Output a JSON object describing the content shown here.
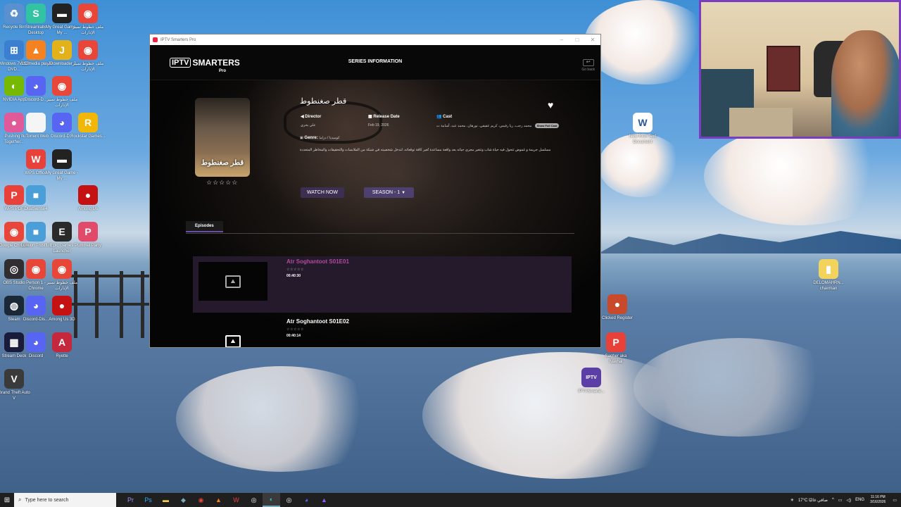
{
  "desktop": {
    "left_icons": [
      {
        "label": "Recycle Bin",
        "icon": "recycle-bin-icon",
        "color": "#5a8fd0",
        "glyph": "♻"
      },
      {
        "label": "Streamlabs Desktop",
        "icon": "streamlabs-icon",
        "color": "#31c3a2",
        "glyph": "S"
      },
      {
        "label": "My Great Game - My ...",
        "icon": "game-icon",
        "color": "#222222",
        "glyph": "▬"
      },
      {
        "label": "ملف خطوط تمييز الإدارات",
        "icon": "chrome-icon",
        "color": "#e9463a",
        "glyph": "◉"
      },
      {
        "label": "Windows 7 USB DVD...",
        "icon": "windows-usb-icon",
        "color": "#3a7fd0",
        "glyph": "⊞"
      },
      {
        "label": "VLC media player",
        "icon": "vlc-icon",
        "color": "#f58220",
        "glyph": "▲"
      },
      {
        "label": "JDownloader 2",
        "icon": "jdownloader-icon",
        "color": "#e3b21b",
        "glyph": "J"
      },
      {
        "label": "ملف خطوط تمييز الإدارات",
        "icon": "chrome-icon",
        "color": "#e9463a",
        "glyph": "◉"
      },
      {
        "label": "NVIDIA App",
        "icon": "nvidia-icon",
        "color": "#76b900",
        "glyph": "◐"
      },
      {
        "label": "Discord-D...",
        "icon": "discord-icon",
        "color": "#5865f2",
        "glyph": "◕"
      },
      {
        "label": "ملف خطوط تمييز الإدارات",
        "icon": "chrome-icon",
        "color": "#e9463a",
        "glyph": "◉"
      },
      {
        "label": "Pushing It Together...",
        "icon": "game2-icon",
        "color": "#e05a9a",
        "glyph": "●"
      },
      {
        "label": "uTorrent Web",
        "icon": "file-icon",
        "color": "#f5f5f5",
        "glyph": ""
      },
      {
        "label": "Discord-D...",
        "icon": "discord-icon",
        "color": "#5865f2",
        "glyph": "◕"
      },
      {
        "label": "Rockstar Games...",
        "icon": "rockstar-icon",
        "color": "#f2b705",
        "glyph": "R"
      },
      {
        "label": "WPS Office",
        "icon": "wps-icon",
        "color": "#e8413a",
        "glyph": "W"
      },
      {
        "label": "My Great Game - My ...",
        "icon": "game-icon",
        "color": "#222222",
        "glyph": "▬"
      },
      {
        "label": "WPS PDF",
        "icon": "wps-pdf-icon",
        "color": "#e8413a",
        "glyph": "P"
      },
      {
        "label": "DualSense4",
        "icon": "app-icon",
        "color": "#4a9fd8",
        "glyph": "■"
      },
      {
        "label": "Among Us",
        "icon": "among-us-icon",
        "color": "#c51111",
        "glyph": "●"
      },
      {
        "label": "Google Chrome",
        "icon": "chrome-icon",
        "color": "#e9463a",
        "glyph": "◉"
      },
      {
        "label": "Lumion Trustfull",
        "icon": "app-icon",
        "color": "#4a9fd8",
        "glyph": "■"
      },
      {
        "label": "Epic Games Launcher",
        "icon": "epic-icon",
        "color": "#2a2a2a",
        "glyph": "E"
      },
      {
        "label": "Pummel Party",
        "icon": "pummel-icon",
        "color": "#e24a6a",
        "glyph": "P"
      },
      {
        "label": "OBS Studio",
        "icon": "obs-icon",
        "color": "#302e31",
        "glyph": "◎"
      },
      {
        "label": "Person 1 - Chrome",
        "icon": "chrome-icon",
        "color": "#e9463a",
        "glyph": "◉"
      },
      {
        "label": "ملف خطوط تمييز الإدارات",
        "icon": "chrome-icon",
        "color": "#e9463a",
        "glyph": "◉"
      },
      {
        "label": "Steam",
        "icon": "steam-icon",
        "color": "#1b2838",
        "glyph": "◍"
      },
      {
        "label": "Discord-Dis...",
        "icon": "discord-icon",
        "color": "#5865f2",
        "glyph": "◕"
      },
      {
        "label": "Among Us 3D",
        "icon": "among-us-icon",
        "color": "#c51111",
        "glyph": "●"
      },
      {
        "label": "Stream Deck",
        "icon": "stream-deck-icon",
        "color": "#1a1a3a",
        "glyph": "▦"
      },
      {
        "label": "Discord",
        "icon": "discord-icon",
        "color": "#5865f2",
        "glyph": "◕"
      },
      {
        "label": "Ryette",
        "icon": "app-icon",
        "color": "#c5283d",
        "glyph": "A"
      },
      {
        "label": "Grand Theft Auto V",
        "icon": "gta-icon",
        "color": "#3a3a3a",
        "glyph": "V"
      }
    ],
    "right_icons": [
      {
        "label": "New Rich Text Document",
        "icon": "document-icon",
        "color": "#ffffff",
        "glyph": "W"
      },
      {
        "label": "Clicked Register",
        "icon": "app-icon",
        "color": "#c94a2a",
        "glyph": "●"
      },
      {
        "label": "Sagher aka Nakhal",
        "icon": "wps-pdf-icon",
        "color": "#e8413a",
        "glyph": "P"
      },
      {
        "label": "IPTVSmarte...",
        "icon": "iptv-icon",
        "color": "#5b3fa6",
        "glyph": "IPTV"
      },
      {
        "label": "DELOMAHRN... chairman",
        "icon": "folder-icon",
        "color": "#f2d35c",
        "glyph": "▮"
      }
    ]
  },
  "window": {
    "title": "IPTV Smarters Pro",
    "header_title": "SERIES INFORMATION",
    "logo_iptv": "IPTV",
    "logo_smarters": "SMARTERS",
    "logo_pro": "Pro",
    "back_label": "Go back",
    "series": {
      "name": "قطر صغنطوط",
      "poster_text": "قطر صغنطوط",
      "director_label": "Director",
      "director_value": "علي بحري",
      "release_label": "Release Date",
      "release_value": "Feb 19, 2026",
      "cast_label": "Cast",
      "cast_value": "محمد رجب، ريا رفيس، كريم عفيفي، نورهان، محمد عبد، أسامة ت",
      "cast_button": "Show Full Cast",
      "genre_label": "Genre:",
      "genre_value": "كوميديا / دراما",
      "description": "مسلسل جريمة و غموض تتحول فيه حياة شاب وتتغير مجرى حياته بعد واقعة مساعدة تُغير كافة توقعاته، لتدخل شخصيته في شبكة من الملابسات والتحقيقات والمخاطر المتعددة",
      "stars": "☆☆☆☆☆"
    },
    "watch_now": "WATCH NOW",
    "season": "SEASON - 1",
    "tab_episodes": "Episodes",
    "episodes": [
      {
        "title": "Atr Soghantoot S01E01",
        "stars": "☆☆☆☆☆",
        "duration": "00:40:30"
      },
      {
        "title": "Atr Soghantoot S01E02",
        "stars": "☆☆☆☆☆",
        "duration": "00:40:14"
      }
    ]
  },
  "taskbar": {
    "search_placeholder": "Type here to search",
    "weather": "17°C صافي غالبًا",
    "language": "ENG",
    "time": "11:16 PM",
    "date": "3/16/2026"
  },
  "colors": {
    "accent_purple": "#6a4fa3",
    "episode_active_title": "#b04aa0",
    "webcam_border": "#7a3dbf"
  }
}
